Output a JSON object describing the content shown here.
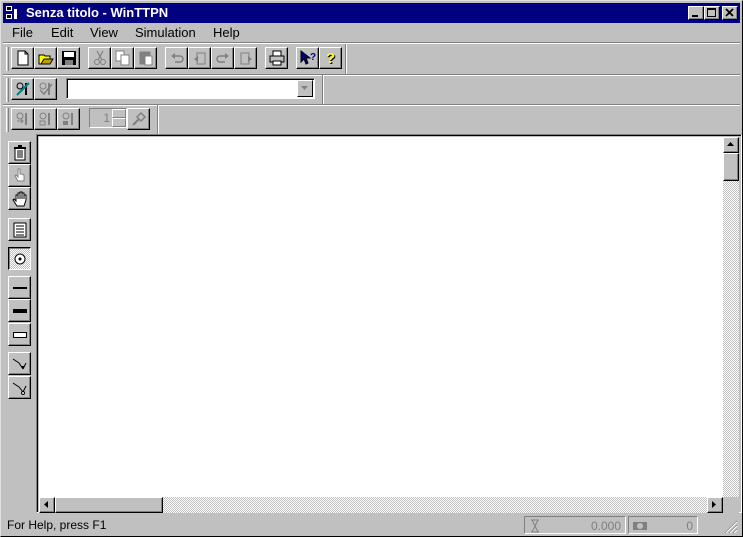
{
  "window": {
    "title": "Senza titolo - WinTTPN"
  },
  "menu": {
    "items": [
      "File",
      "Edit",
      "View",
      "Simulation",
      "Help"
    ]
  },
  "toolbar_main": {
    "buttons": [
      "new-icon",
      "open-icon",
      "save-icon",
      "cut-icon",
      "copy-icon",
      "paste-icon",
      "undo-icon",
      "undo-step-icon",
      "redo-icon",
      "redo-step-icon",
      "print-icon",
      "context-help-icon",
      "help-icon"
    ]
  },
  "toolbar_combo": {
    "selected_value": ""
  },
  "toolbar_sim": {
    "spin_value": "1"
  },
  "palette": {
    "tools": [
      "delete-icon",
      "pointer-hand-icon",
      "grab-hand-icon",
      "properties-icon",
      "place-icon",
      "immediate-transition-icon",
      "timed-transition-icon",
      "deterministic-transition-icon",
      "arc-icon",
      "inhibitor-arc-icon"
    ],
    "selected": "place-icon"
  },
  "status": {
    "help_text": "For Help, press F1",
    "time_value": "0.000",
    "count_value": "0"
  },
  "colors": {
    "titlebar": "#000080",
    "face": "#c0c0c0",
    "canvas": "#ffffff"
  }
}
